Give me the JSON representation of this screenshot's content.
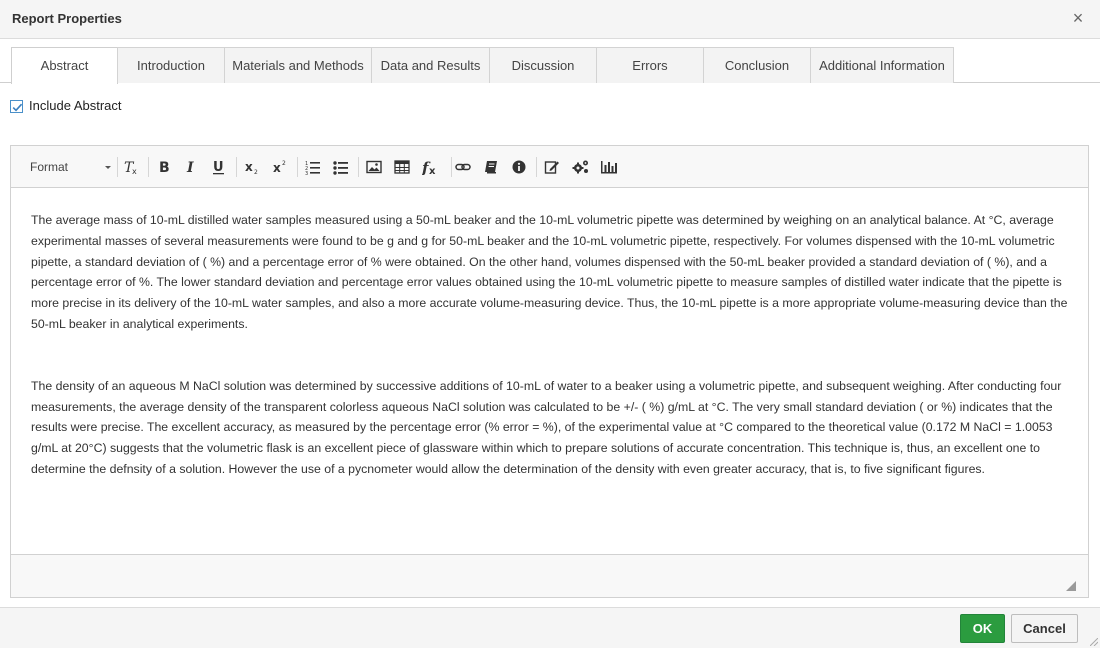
{
  "dialog": {
    "title": "Report Properties",
    "close_glyph": "×"
  },
  "tabs": [
    {
      "label": "Abstract",
      "active": true
    },
    {
      "label": "Introduction",
      "active": false
    },
    {
      "label": "Materials and Methods",
      "active": false
    },
    {
      "label": "Data and Results",
      "active": false
    },
    {
      "label": "Discussion",
      "active": false
    },
    {
      "label": "Errors",
      "active": false
    },
    {
      "label": "Conclusion",
      "active": false
    },
    {
      "label": "Additional Information",
      "active": false
    }
  ],
  "include_abstract": {
    "label": "Include Abstract",
    "checked": true
  },
  "toolbar": {
    "format_label": "Format",
    "icons": [
      "remove-format-icon",
      "bold-icon",
      "italic-icon",
      "underline-icon",
      "subscript-icon",
      "superscript-icon",
      "numbered-list-icon",
      "bulleted-list-icon",
      "image-icon",
      "table-icon",
      "formula-icon",
      "link-icon",
      "book-icon",
      "info-icon",
      "edit-icon",
      "settings-icon",
      "chart-icon"
    ]
  },
  "content": {
    "paragraph1": "The average mass of 10-mL distilled water samples measured using a 50-mL beaker and the 10-mL volumetric pipette was determined by weighing on an analytical balance. At °C, average experimental masses of several measurements were found to be g and g for 50-mL beaker and the 10-mL volumetric pipette, respectively. For volumes dispensed with the 10-mL volumetric pipette, a standard deviation of ( %) and a percentage error of % were obtained. On the other hand, volumes dispensed with the 50-mL beaker provided a standard deviation of ( %), and a percentage error of %. The lower standard deviation and percentage error values obtained using the 10-mL volumetric pipette to measure samples of distilled water indicate that the pipette is more precise in its delivery of the 10-mL water samples, and also a more accurate volume-measuring device. Thus, the 10-mL pipette is a more appropriate volume-measuring device than the 50-mL beaker in analytical experiments.",
    "paragraph2": "The density of an aqueous M NaCl solution was determined by successive additions of 10-mL of water to a beaker using a volumetric pipette, and subsequent weighing. After conducting four measurements, the average density of the transparent colorless aqueous NaCl solution was calculated to be +/- ( %) g/mL at °C. The very small standard deviation ( or %) indicates that the results were precise. The excellent accuracy, as measured by the percentage error (% error = %), of the experimental value at °C compared to the theoretical value (0.172 M NaCl = 1.0053 g/mL at 20°C) suggests that the volumetric flask is an excellent piece of glassware within which to prepare solutions of accurate concentration. This technique is, thus, an excellent one to determine the defnsity of a solution. However the use of a pycnometer would allow the determination of the density with even greater accuracy, that is, to five significant figures."
  },
  "footer": {
    "ok_label": "OK",
    "cancel_label": "Cancel"
  },
  "colors": {
    "ok_green": "#2b9c3f",
    "checkbox_blue": "#4a90c9"
  }
}
